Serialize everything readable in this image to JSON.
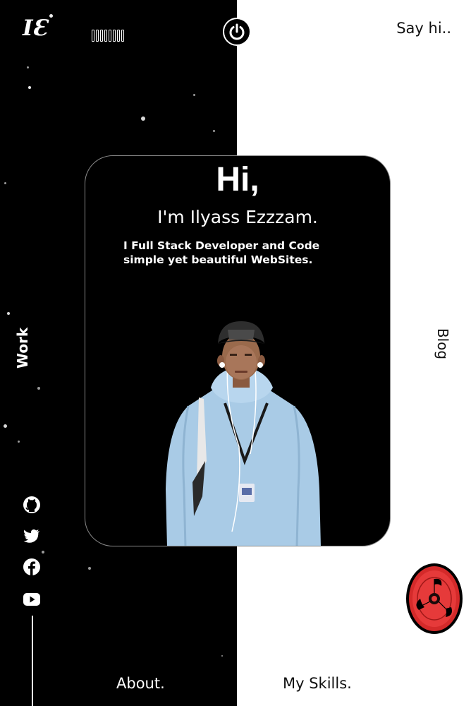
{
  "header": {
    "logo_text": "IƐ",
    "power_icon": "power-icon",
    "say_hi_label": "Say hi.."
  },
  "intro": {
    "greeting": "Hi,",
    "name_line": "I'm Ilyass Ezzzam.",
    "description": "I Full Stack Developer and Code simple yet beautiful WebSites."
  },
  "nav": {
    "work_label": "Work",
    "blog_label": "Blog",
    "about_label": "About.",
    "skills_label": "My Skills."
  },
  "social_icons": [
    "github-icon",
    "twitter-icon",
    "facebook-icon",
    "youtube-icon"
  ],
  "colors": {
    "dark_panel": "#000000",
    "light_panel": "#ffffff",
    "eye_red": "#e03030"
  }
}
